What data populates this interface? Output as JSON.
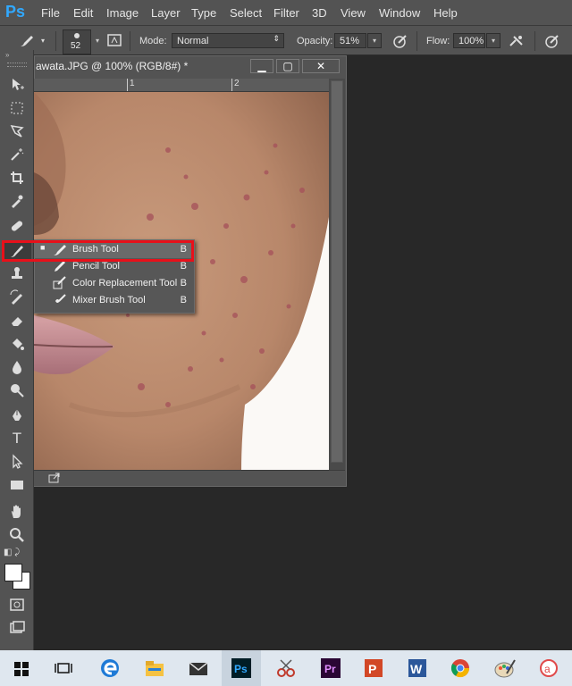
{
  "menubar": {
    "logo": "Ps",
    "items": [
      "File",
      "Edit",
      "Image",
      "Layer",
      "Type",
      "Select",
      "Filter",
      "3D",
      "View",
      "Window",
      "Help"
    ]
  },
  "options": {
    "brush_size": "52",
    "mode_label": "Mode:",
    "mode_value": "Normal",
    "opacity_label": "Opacity:",
    "opacity_value": "51%",
    "flow_label": "Flow:",
    "flow_value": "100%"
  },
  "document": {
    "title": "awata.JPG @ 100% (RGB/8#) *",
    "ruler_marks": [
      "1",
      "2"
    ],
    "window_buttons": [
      "▭",
      "▢",
      "✕"
    ]
  },
  "flyout": {
    "items": [
      {
        "label": "Brush Tool",
        "key": "B",
        "icon": "brush-icon",
        "active": true
      },
      {
        "label": "Pencil Tool",
        "key": "B",
        "icon": "pencil-icon",
        "active": false
      },
      {
        "label": "Color Replacement Tool",
        "key": "B",
        "icon": "color-replacement-icon",
        "active": false
      },
      {
        "label": "Mixer Brush Tool",
        "key": "B",
        "icon": "mixer-brush-icon",
        "active": false
      }
    ]
  },
  "tools": [
    "move-icon",
    "marquee-icon",
    "lasso-icon",
    "magic-wand-icon",
    "crop-icon",
    "eyedropper-icon",
    "healing-icon",
    "brush-icon",
    "stamp-icon",
    "history-brush-icon",
    "eraser-icon",
    "paint-bucket-icon",
    "blur-icon",
    "dodge-icon",
    "pen-icon",
    "type-icon",
    "path-select-icon",
    "rectangle-icon",
    "hand-icon",
    "zoom-icon"
  ],
  "taskbar": {
    "icons": [
      "windows-start-icon",
      "task-view-icon",
      "edge-icon",
      "file-explorer-icon",
      "mail-icon",
      "photoshop-icon",
      "snipping-icon",
      "premiere-icon",
      "powerpoint-icon",
      "word-icon",
      "chrome-icon",
      "paint-icon",
      "app-icon"
    ]
  },
  "colors": {
    "accent_ps": "#31a8ff",
    "panel": "#535353",
    "highlight": "#e8101a",
    "taskbar": "#dfe7ef"
  }
}
